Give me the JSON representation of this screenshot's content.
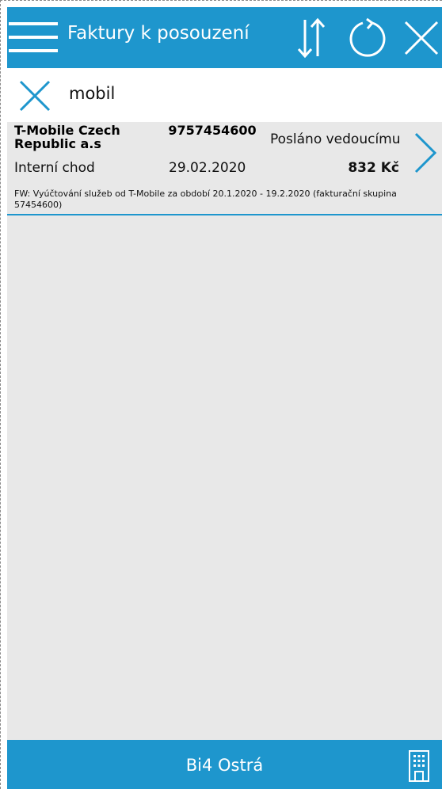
{
  "header": {
    "title": "Faktury k posouzení",
    "icons": [
      "menu-icon",
      "sort-icon",
      "refresh-icon",
      "close-icon"
    ]
  },
  "search": {
    "value": "mobil",
    "clear_icon": "close-icon"
  },
  "invoices": [
    {
      "company": "T-Mobile Czech Republic a.s",
      "number": "9757454600",
      "status": "Posláno vedoucímu",
      "type": "Interní chod",
      "date": "29.02.2020",
      "amount": "832 Kč",
      "description": "FW: Vyúčtování služeb od T-Mobile za období 20.1.2020 - 19.2.2020 (fakturační skupina 57454600)"
    }
  ],
  "footer": {
    "label": "Bi4 Ostrá",
    "icon": "building-icon"
  },
  "colors": {
    "accent": "#1e96cd",
    "background": "#e8e8e8"
  }
}
